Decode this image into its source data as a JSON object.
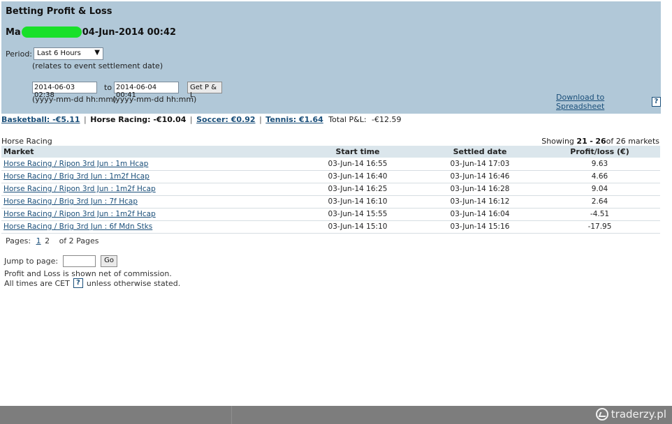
{
  "header": {
    "title": "Betting Profit & Loss",
    "account_prefix": "Ma",
    "timestamp": "04-Jun-2014 00:42"
  },
  "filters": {
    "period_label": "Period:",
    "period_value": "Last 6 Hours",
    "relates_note": "(relates to event settlement date)",
    "from_value": "2014-06-03 02:38",
    "to_label": "to",
    "to_value": "2014-06-04 00:41",
    "from_format": "(yyyy-mm-dd hh:mm)",
    "to_format": "(yyyy-mm-dd hh:mm)",
    "get_button": "Get P & L",
    "download_link": "Download to Spreadsheet",
    "help_glyph": "?"
  },
  "totals": {
    "basketball": "Basketball: -€5.11",
    "horse_racing": "Horse Racing: -€10.04",
    "soccer": "Soccer: €0.92",
    "tennis": "Tennis: €1.64",
    "total_label": "Total P&L:",
    "total_value": "-€12.59",
    "separator": "|"
  },
  "section": {
    "title": "Horse Racing",
    "showing_prefix": "Showing",
    "range_start": "21",
    "range_dash": "-",
    "range_end": "26",
    "showing_suffix": "of 26 markets"
  },
  "table": {
    "headers": {
      "market": "Market",
      "start": "Start time",
      "settled": "Settled date",
      "profit": "Profit/loss (€)"
    },
    "rows": [
      {
        "market": "Horse Racing / Ripon 3rd Jun : 1m Hcap",
        "start": "03-Jun-14 16:55",
        "settled": "03-Jun-14 17:03",
        "profit": "9.63"
      },
      {
        "market": "Horse Racing / Brig 3rd Jun : 1m2f Hcap",
        "start": "03-Jun-14 16:40",
        "settled": "03-Jun-14 16:46",
        "profit": "4.66"
      },
      {
        "market": "Horse Racing / Ripon 3rd Jun : 1m2f Hcap",
        "start": "03-Jun-14 16:25",
        "settled": "03-Jun-14 16:28",
        "profit": "9.04"
      },
      {
        "market": "Horse Racing / Brig 3rd Jun : 7f Hcap",
        "start": "03-Jun-14 16:10",
        "settled": "03-Jun-14 16:12",
        "profit": "2.64"
      },
      {
        "market": "Horse Racing / Ripon 3rd Jun : 1m2f Hcap",
        "start": "03-Jun-14 15:55",
        "settled": "03-Jun-14 16:04",
        "profit": "-4.51"
      },
      {
        "market": "Horse Racing / Brig 3rd Jun : 6f Mdn Stks",
        "start": "03-Jun-14 15:10",
        "settled": "03-Jun-14 15:16",
        "profit": "-17.95"
      }
    ]
  },
  "pagination": {
    "label": "Pages:",
    "page1": "1",
    "page2": "2",
    "suffix": "of 2 Pages",
    "jump_label": "Jump to page:",
    "go_button": "Go"
  },
  "notes": {
    "commission": "Profit and Loss is shown net of commission.",
    "times_prefix": "All times are CET",
    "times_suffix": "unless otherwise stated."
  },
  "watermark": {
    "text": "traderzy.pl"
  }
}
